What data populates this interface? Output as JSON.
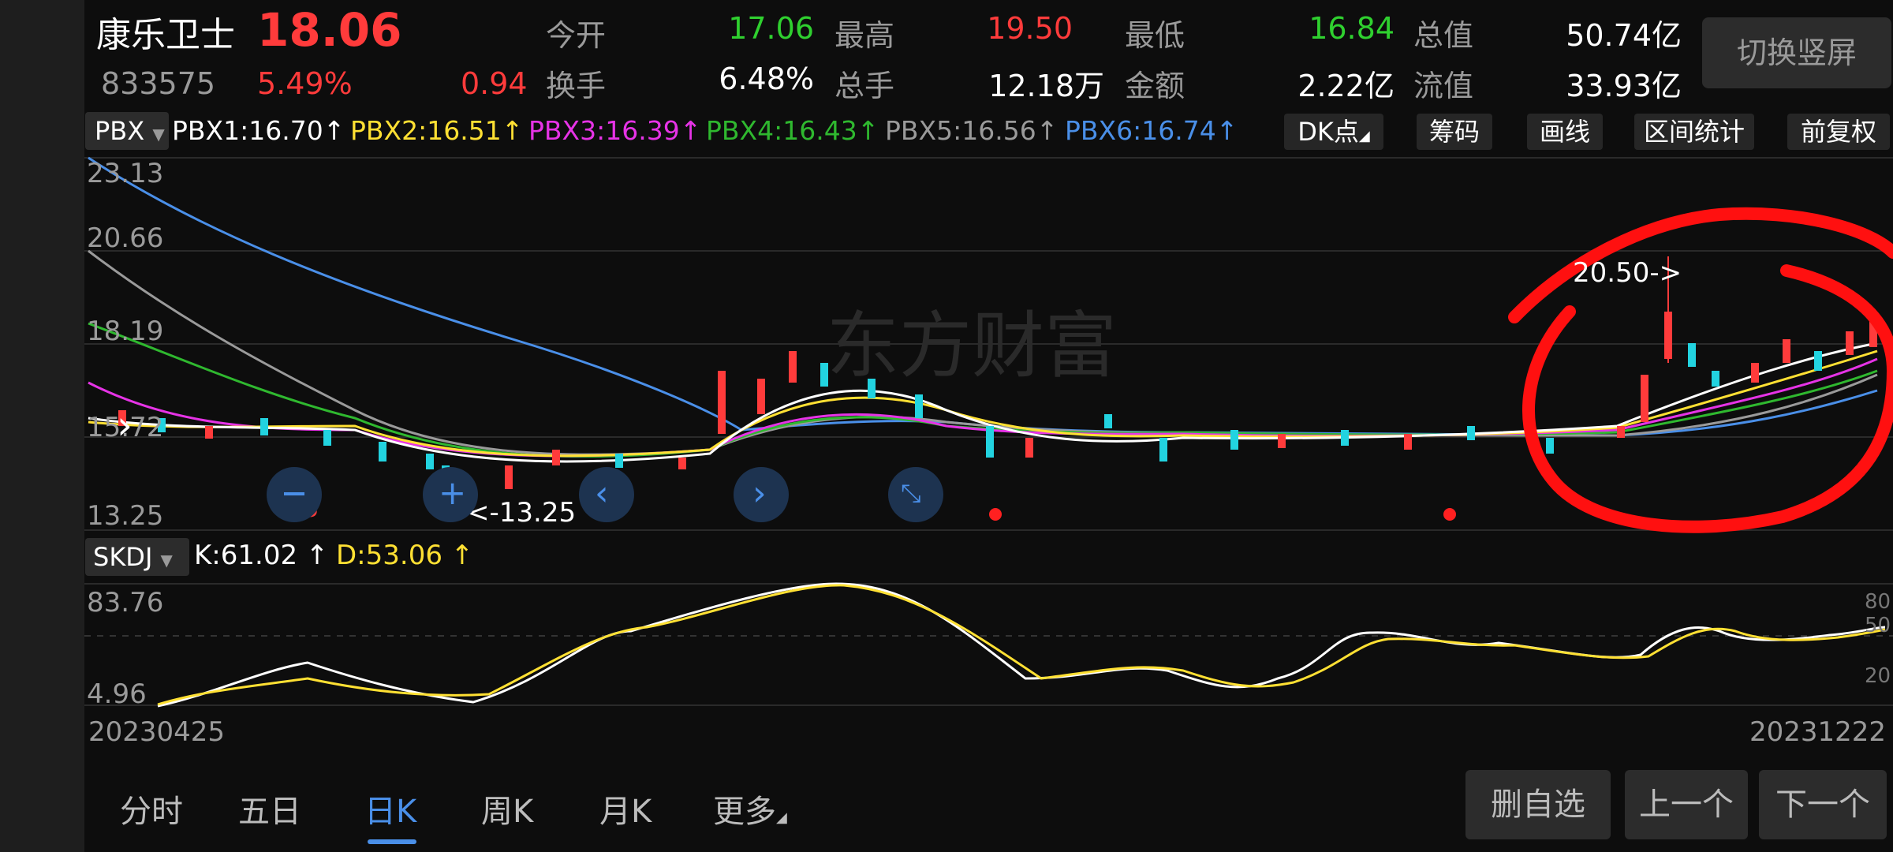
{
  "stock": {
    "name": "康乐卫士",
    "price": "18.06",
    "code": "833575",
    "change_pct": "5.49%",
    "change": "0.94"
  },
  "quote": {
    "open_label": "今开",
    "open": "17.06",
    "high_label": "最高",
    "high": "19.50",
    "low_label": "最低",
    "low": "16.84",
    "mktcap_label": "总值",
    "mktcap": "50.74亿",
    "turnover_label": "换手",
    "turnover": "6.48%",
    "volume_label": "总手",
    "volume": "12.18万",
    "amount_label": "金额",
    "amount": "2.22亿",
    "float_label": "流值",
    "float_cap": "33.93亿"
  },
  "switch_button": "切换竖屏",
  "indicator": {
    "selector": "PBX",
    "items": [
      {
        "label": "PBX1:16.70",
        "color": "#ffffff"
      },
      {
        "label": "PBX2:16.51",
        "color": "#ffe033"
      },
      {
        "label": "PBX3:16.39",
        "color": "#e633e6"
      },
      {
        "label": "PBX4:16.43",
        "color": "#2fb82f"
      },
      {
        "label": "PBX5:16.56",
        "color": "#9a9a9a"
      },
      {
        "label": "PBX6:16.74",
        "color": "#4a8fe8"
      }
    ],
    "arrow": "↑"
  },
  "tools": {
    "dk": "DK点",
    "chips": "筹码",
    "draw": "画线",
    "range": "区间统计",
    "adjust": "前复权"
  },
  "price_axis": [
    "23.13",
    "20.66",
    "18.19",
    "15.72",
    "13.25"
  ],
  "annotations": {
    "high_mark": "20.50->",
    "low_mark": "<-13.25",
    "s_mark": "S"
  },
  "kdj": {
    "selector": "SKDJ",
    "k": "K:61.02",
    "d": "D:53.06",
    "axis_left": [
      "83.76",
      "4.96"
    ],
    "axis_right": [
      "80",
      "50",
      "20"
    ]
  },
  "dates": {
    "start": "20230425",
    "end": "20231222"
  },
  "tabs": [
    "分时",
    "五日",
    "日K",
    "周K",
    "月K",
    "更多"
  ],
  "active_tab": "日K",
  "bottom_buttons": {
    "delete": "删自选",
    "prev": "上一个",
    "next": "下一个"
  },
  "watermark": "东方财富",
  "colors": {
    "up": "#ff3b3b",
    "down": "#22d3e0",
    "accent": "#4a8fe8"
  }
}
